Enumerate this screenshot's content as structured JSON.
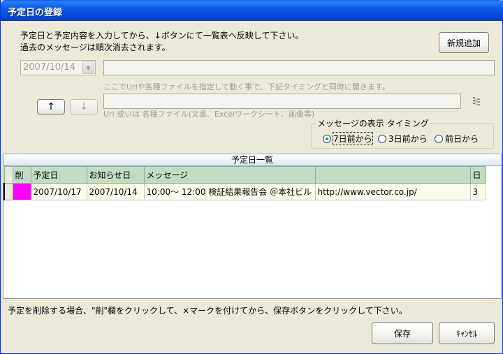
{
  "window": {
    "title": "予定日の登録"
  },
  "instructions": {
    "line1": "予定日と予定内容を入力してから、↓ボタンにて一覧表へ反映して下さい。",
    "line2": "過去のメッセージは順次消去されます。"
  },
  "new_button_label": "新規追加",
  "date_combo": {
    "value": "2007/10/14"
  },
  "message_input": {
    "value": ""
  },
  "link_hint": "ここでUrlや各種ファイルを指定して動く事で、下記タイミングと同時に開きます。",
  "link_input": {
    "value": "",
    "hint": "Url 或いは  各種ファイル(文書、Excelワークシート、画像等)"
  },
  "up_button_label": "↑",
  "down_button_label": "↓",
  "timing": {
    "legend": "メッセージの表示  タイミング",
    "options": [
      {
        "label": "7日前から",
        "selected": true
      },
      {
        "label": "3日前から",
        "selected": false
      },
      {
        "label": "前日から",
        "selected": false
      }
    ]
  },
  "list": {
    "title": "予定日一覧",
    "columns": [
      "削",
      "予定日",
      "お知らせ日",
      "メッセージ",
      "",
      "日"
    ],
    "rows": [
      {
        "delete_color": "#ff00ff",
        "date": "2007/10/17",
        "notify": "2007/10/14",
        "message": "10:00～ 12:00  検証結果報告会  ＠本社ビル",
        "url": "http://www.vector.co.jp/",
        "days": "3"
      }
    ]
  },
  "footer": {
    "note": "予定を削除する場合、\"削\"欄をクリックして、×マークを付けてから、保存ボタンをクリックして下さい。",
    "save_label": "保存",
    "cancel_label": "ｷｬﾝｾﾙ"
  }
}
